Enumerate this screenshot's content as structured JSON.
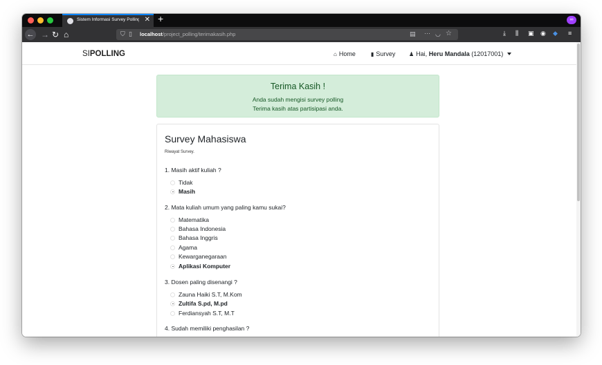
{
  "browser": {
    "tab_title": "Sistem Informasi Survey Polling",
    "tab_close": "✕",
    "new_tab": "+",
    "url_host": "localhost",
    "url_path": "/project_polling/terimakasih.php",
    "icons": [
      "back-icon",
      "forward-icon",
      "reload-icon",
      "home-icon",
      "shield-icon",
      "page-icon",
      "reader-icon",
      "more-icon",
      "pocket-icon",
      "bookmark-star-icon",
      "download-icon",
      "library-icon",
      "sidebar-icon",
      "account-icon",
      "extension-icon",
      "menu-icon",
      "private-mask-icon"
    ]
  },
  "navbar": {
    "brand_light": "SI",
    "brand_bold": "POLLING",
    "home_label": "Home",
    "survey_label": "Survey",
    "user_greeting": "Hai,",
    "user_name": "Heru Mandala",
    "user_id": "(12017001)"
  },
  "alert": {
    "title": "Terima Kasih !",
    "line1": "Anda sudah mengisi survey polling",
    "line2": "Terima kasih atas partisipasi anda.",
    "bg_color": "#d4edda",
    "text_color": "#155724"
  },
  "survey": {
    "title": "Survey Mahasiswa",
    "subtitle": "Riwayat Survey.",
    "questions": [
      {
        "text": "1. Masih aktif kuliah ?",
        "options": [
          "Tidak",
          "Masih"
        ],
        "selected": "Masih"
      },
      {
        "text": "2. Mata kuliah umum yang paling kamu sukai?",
        "options": [
          "Matematika",
          "Bahasa Indonesia",
          "Bahasa Inggris",
          "Agama",
          "Kewarganegaraan",
          "Aplikasi Komputer"
        ],
        "selected": "Aplikasi Komputer"
      },
      {
        "text": "3. Dosen paling disenangi ?",
        "options": [
          "Zauna Haiki S.T, M.Kom",
          "Zultifa S.pd, M.pd",
          "Ferdiansyah S.T, M.T"
        ],
        "selected": "Zultifa S.pd, M.pd"
      },
      {
        "text": "4. Sudah memiliki penghasilan ?",
        "options": [],
        "selected": null
      }
    ]
  }
}
